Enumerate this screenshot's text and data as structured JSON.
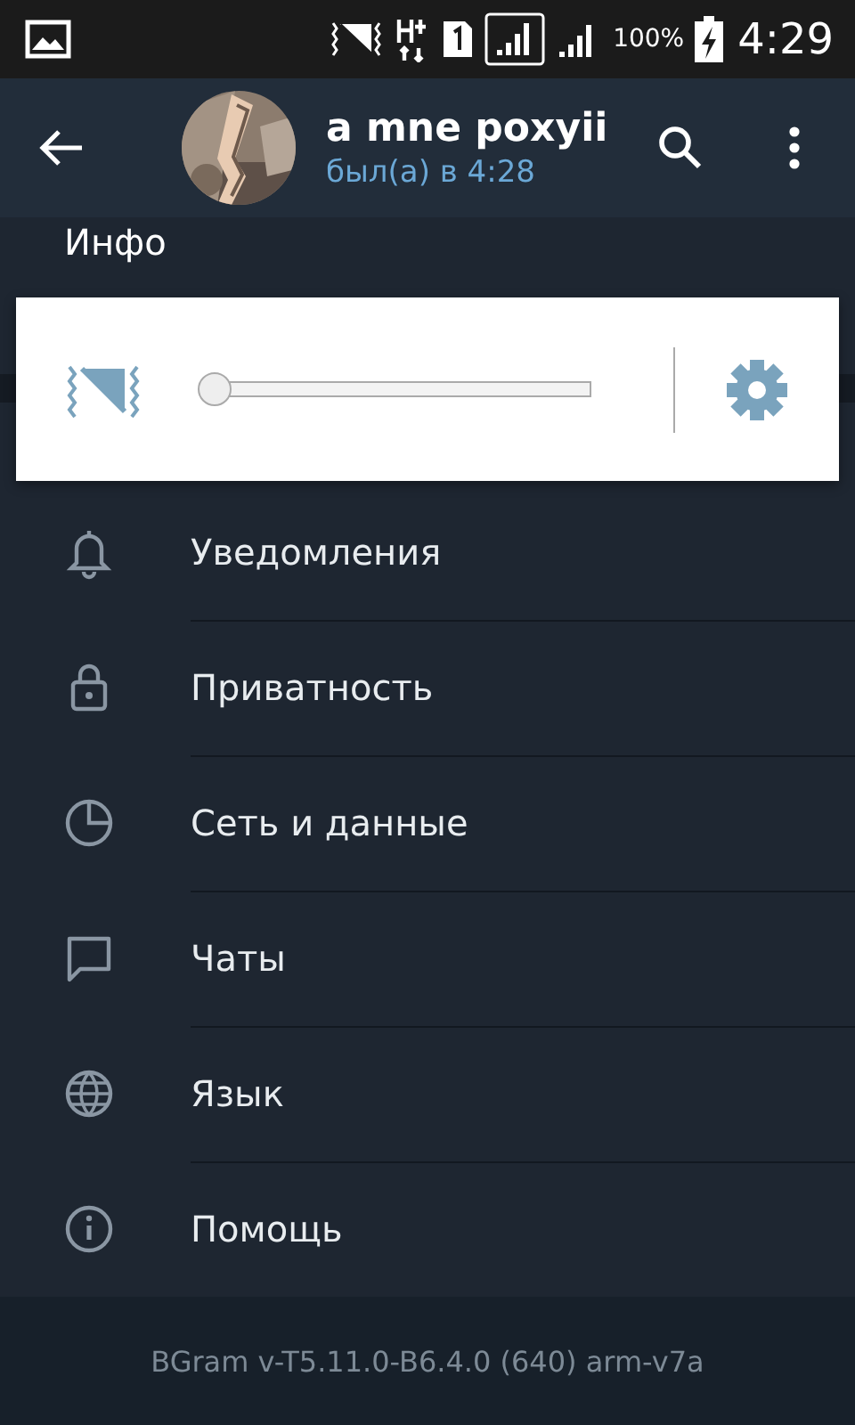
{
  "status_bar": {
    "battery": "100%",
    "time": "4:29"
  },
  "header": {
    "title": "a mne poxyii",
    "subtitle": "был(а) в 4:28"
  },
  "info": {
    "heading": "Инфо"
  },
  "volume_panel": {
    "level": 0
  },
  "menu": [
    {
      "kind": "bell",
      "label": "Уведомления"
    },
    {
      "kind": "lock",
      "label": "Приватность"
    },
    {
      "kind": "clock",
      "label": "Сеть и данные"
    },
    {
      "kind": "chat",
      "label": "Чаты"
    },
    {
      "kind": "globe",
      "label": "Язык"
    },
    {
      "kind": "info",
      "label": "Помощь"
    }
  ],
  "footer": {
    "version": "BGram v-T5.11.0-B6.4.0 (640) arm-v7a"
  }
}
